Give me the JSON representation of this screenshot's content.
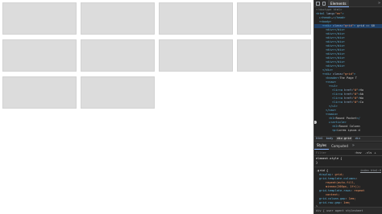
{
  "page": {
    "grid_cells": 10
  },
  "devtools": {
    "tabs": [
      "Elements",
      "»"
    ],
    "active_tab": "Elements",
    "dom_lines": [
      {
        "indent": 0,
        "parts": [
          [
            "comment",
            "<!doctype html>"
          ]
        ]
      },
      {
        "indent": 0,
        "parts": [
          [
            "tag",
            "<html "
          ],
          [
            "attr",
            "lang="
          ],
          [
            "val",
            "\"en\""
          ],
          [
            "tag",
            ">"
          ]
        ]
      },
      {
        "indent": 1,
        "parts": [
          [
            "tag",
            "▸<head>"
          ],
          [
            "txt",
            "…"
          ],
          [
            "tag",
            "</head>"
          ]
        ]
      },
      {
        "indent": 1,
        "parts": [
          [
            "tag",
            "▾<body>"
          ]
        ]
      },
      {
        "indent": 2,
        "parts": [
          [
            "tag",
            "▾<div "
          ],
          [
            "attr",
            "class="
          ],
          [
            "val",
            "\"grid\""
          ],
          [
            "tag",
            "> "
          ],
          [
            "txt",
            "grid == $0"
          ]
        ],
        "selected": true
      },
      {
        "indent": 3,
        "parts": [
          [
            "tag",
            "<div></div>"
          ]
        ]
      },
      {
        "indent": 3,
        "parts": [
          [
            "tag",
            "<div></div>"
          ]
        ]
      },
      {
        "indent": 3,
        "parts": [
          [
            "tag",
            "<div></div>"
          ]
        ]
      },
      {
        "indent": 3,
        "parts": [
          [
            "tag",
            "<div></div>"
          ]
        ]
      },
      {
        "indent": 3,
        "parts": [
          [
            "tag",
            "<div></div>"
          ]
        ]
      },
      {
        "indent": 3,
        "parts": [
          [
            "tag",
            "<div></div>"
          ]
        ]
      },
      {
        "indent": 3,
        "parts": [
          [
            "tag",
            "<div></div>"
          ]
        ]
      },
      {
        "indent": 3,
        "parts": [
          [
            "tag",
            "<div></div>"
          ]
        ]
      },
      {
        "indent": 3,
        "parts": [
          [
            "tag",
            "<div></div>"
          ]
        ]
      },
      {
        "indent": 3,
        "parts": [
          [
            "tag",
            "<div></div>"
          ]
        ]
      },
      {
        "indent": 2,
        "parts": [
          [
            "tag",
            "</div>"
          ]
        ]
      },
      {
        "indent": 2,
        "parts": [
          [
            "tag",
            "▾<div "
          ],
          [
            "attr",
            "class="
          ],
          [
            "val",
            "\"grid\""
          ],
          [
            "tag",
            ">"
          ]
        ]
      },
      {
        "indent": 3,
        "parts": [
          [
            "tag",
            "<header>"
          ],
          [
            "txt",
            "The Page T"
          ]
        ]
      },
      {
        "indent": 3,
        "parts": [
          [
            "tag",
            "▾<nav>"
          ]
        ]
      },
      {
        "indent": 4,
        "parts": [
          [
            "tag",
            "▾<ul>"
          ]
        ]
      },
      {
        "indent": 5,
        "parts": [
          [
            "tag",
            "<li><a "
          ],
          [
            "attr",
            "href="
          ],
          [
            "val",
            "\"#\""
          ],
          [
            "tag",
            ">"
          ],
          [
            "txt",
            "Ho"
          ]
        ]
      },
      {
        "indent": 5,
        "parts": [
          [
            "tag",
            "<li><a "
          ],
          [
            "attr",
            "href="
          ],
          [
            "val",
            "\"#\""
          ],
          [
            "tag",
            ">"
          ],
          [
            "txt",
            "Ab"
          ]
        ]
      },
      {
        "indent": 5,
        "parts": [
          [
            "tag",
            "<li><a "
          ],
          [
            "attr",
            "href="
          ],
          [
            "val",
            "\"#\""
          ],
          [
            "tag",
            ">"
          ],
          [
            "txt",
            "Wo"
          ]
        ]
      },
      {
        "indent": 5,
        "parts": [
          [
            "tag",
            "<li><a "
          ],
          [
            "attr",
            "href="
          ],
          [
            "val",
            "\"#\""
          ],
          [
            "tag",
            ">"
          ],
          [
            "txt",
            "Co"
          ]
        ]
      },
      {
        "indent": 4,
        "parts": [
          [
            "tag",
            "</ul>"
          ]
        ]
      },
      {
        "indent": 3,
        "parts": [
          [
            "tag",
            "</nav>"
          ]
        ]
      },
      {
        "indent": 3,
        "parts": [
          [
            "tag",
            "▾<main>"
          ]
        ]
      },
      {
        "indent": 4,
        "parts": [
          [
            "tag",
            "<h1>"
          ],
          [
            "txt",
            "Round Pocket"
          ],
          [
            "tag",
            "</"
          ]
        ]
      },
      {
        "indent": 4,
        "parts": [
          [
            "tag",
            "▸<article>"
          ]
        ]
      },
      {
        "indent": 5,
        "parts": [
          [
            "tag",
            "<h2>"
          ],
          [
            "txt",
            "Round Column"
          ]
        ]
      },
      {
        "indent": 5,
        "parts": [
          [
            "tag",
            "<p>"
          ],
          [
            "txt",
            "Lorem ipsum d"
          ]
        ]
      }
    ],
    "breadcrumbs": [
      "html",
      "body",
      "div.grid",
      "div"
    ],
    "active_crumb": "div.grid",
    "styles_tabs": [
      "Styles",
      "Computed",
      "»"
    ],
    "active_styles_tab": "Styles",
    "filter_placeholder": "Filter",
    "filter_hov": ":hov",
    "filter_cls": ".cls",
    "filter_plus": "+",
    "rules": [
      {
        "selector": "element.style {",
        "source": "",
        "decls": [],
        "close": "}"
      },
      {
        "selector": ".grid {",
        "source": "index.html:6",
        "decls": [
          [
            "display",
            "grid;"
          ],
          [
            "grid-template-columns",
            ""
          ],
          [
            "",
            "repeat(auto-fill,"
          ],
          [
            "",
            "minmax(200px, 1fr));"
          ],
          [
            "grid-template-rows",
            "repeat"
          ],
          [
            "",
            "content;"
          ],
          [
            "grid-column-gap",
            "1em;"
          ],
          [
            "grid-row-gap",
            "1em;"
          ]
        ],
        "close": "}"
      }
    ],
    "bottom_text": "div {         user agent stylesheet"
  }
}
